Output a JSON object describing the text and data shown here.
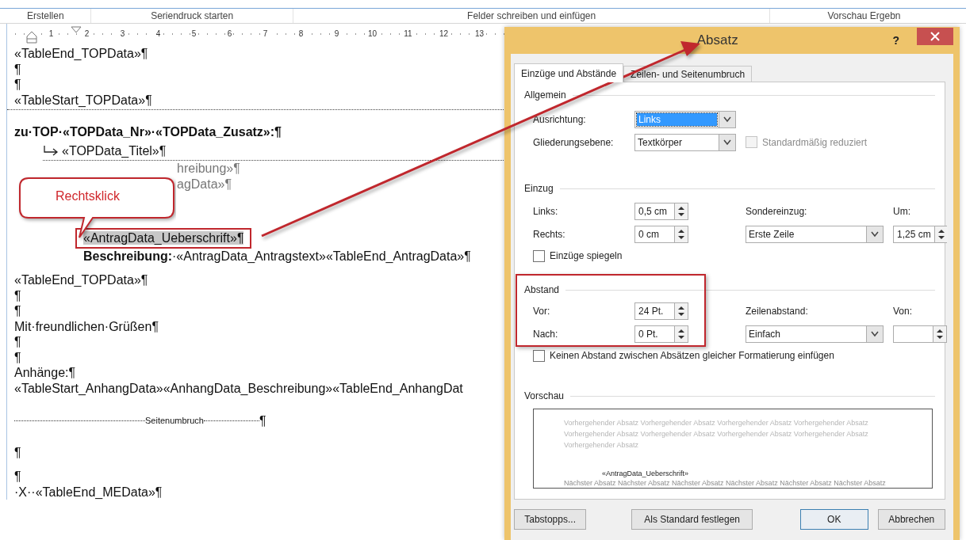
{
  "ribbon_groups": [
    "Erstellen",
    "Seriendruck starten",
    "Felder schreiben und einfügen",
    "Vorschau Ergebn"
  ],
  "ruler": [
    "1",
    "2",
    "3",
    "4",
    "5",
    "6",
    "7",
    "8",
    "9",
    "10",
    "11",
    "12",
    "13"
  ],
  "document": [
    {
      "kind": "plain",
      "text": "«TableEnd_TOPData»¶"
    },
    {
      "kind": "plain",
      "text": "¶"
    },
    {
      "kind": "plain",
      "text": "¶"
    },
    {
      "kind": "table_start",
      "text": "«TableStart_TOPData»¶"
    },
    {
      "kind": "heading",
      "text": "zu·TOP·«TOPData_Nr»·«TOPData_Zusatz»:¶"
    },
    {
      "kind": "sub",
      "text": "«TOPData_Titel»¶"
    },
    {
      "kind": "faded",
      "text": "hreibung»¶"
    },
    {
      "kind": "faded",
      "text": "agData»¶"
    },
    {
      "kind": "selected",
      "text": "«AntragData_Ueberschrift»¶"
    },
    {
      "kind": "detail",
      "text": "**Beschreibung:**·«AntragData_Antragstext»«TableEnd_AntragData»¶"
    },
    {
      "kind": "spaced",
      "text": "«TableEnd_TOPData»¶"
    },
    {
      "kind": "plain",
      "text": "¶"
    },
    {
      "kind": "plain",
      "text": "¶"
    },
    {
      "kind": "plain",
      "text": "Mit·freundlichen·Grüßen¶"
    },
    {
      "kind": "plain",
      "text": "¶"
    },
    {
      "kind": "plain",
      "text": "¶"
    },
    {
      "kind": "plain",
      "text": "Anhänge:¶"
    },
    {
      "kind": "plain",
      "text": "«TableStart_AnhangData»«AnhangData_Beschreibung»«TableEnd_AnhangDat"
    },
    {
      "kind": "page_break",
      "text": "Seitenumbruch",
      "mark": "¶"
    },
    {
      "kind": "plain",
      "text": "¶"
    },
    {
      "kind": "spaced",
      "text": "¶"
    },
    {
      "kind": "plain",
      "text": "·X··«TableEnd_MEData»¶"
    }
  ],
  "callout": {
    "text": "Rechtsklick"
  },
  "dialog": {
    "title": "Absatz",
    "help": "?",
    "tabs": [
      {
        "label": "Einzüge und Abstände",
        "selected": true
      },
      {
        "label": "Zeilen- und Seitenumbruch",
        "selected": false
      }
    ],
    "general": {
      "title": "Allgemein",
      "alignment": {
        "label": "Ausrichtung:",
        "value": "Links",
        "highlighted": true
      },
      "outline_level": {
        "label": "Gliederungsebene:",
        "value": "Textkörper",
        "highlighted": false
      },
      "collapsed": {
        "label": "Standardmäßig reduziert",
        "checked": false,
        "disabled": true
      }
    },
    "indent": {
      "title": "Einzug",
      "left": {
        "label": "Links:",
        "value": "0,5 cm"
      },
      "right": {
        "label": "Rechts:",
        "value": "0 cm"
      },
      "special": {
        "label": "Sondereinzug:",
        "value": "Erste Zeile"
      },
      "by": {
        "label": "Um:",
        "value": "1,25 cm"
      },
      "mirror": {
        "label": "Einzüge spiegeln",
        "checked": false,
        "disabled": false
      }
    },
    "spacing": {
      "title": "Abstand",
      "before": {
        "label": "Vor:",
        "value": "24 Pt."
      },
      "after": {
        "label": "Nach:",
        "value": "0 Pt."
      },
      "line": {
        "label": "Zeilenabstand:",
        "value": "Einfach"
      },
      "at": {
        "label": "Von:"
      },
      "no_space": {
        "label": "Keinen Abstand zwischen Absätzen gleicher Formatierung einfügen",
        "checked": false,
        "disabled": false
      }
    },
    "preview": {
      "title": "Vorschau",
      "preceding_lines": [
        "Vorhergehender Absatz Vorhergehender Absatz Vorhergehender Absatz Vorhergehender Absatz",
        "Vorhergehender Absatz Vorhergehender Absatz Vorhergehender Absatz Vorhergehender Absatz",
        "Vorhergehender Absatz"
      ],
      "sample": "«AntragData_Ueberschrift»",
      "following": "Nächster Absatz Nächster Absatz Nächster Absatz Nächster Absatz Nächster Absatz Nächster Absatz"
    },
    "buttons": [
      {
        "label": "Tabstopps...",
        "default": false
      },
      {
        "label": "Als Standard festlegen",
        "default": false
      },
      {
        "label": "OK",
        "default": true
      },
      {
        "label": "Abbrechen",
        "default": false
      }
    ]
  }
}
